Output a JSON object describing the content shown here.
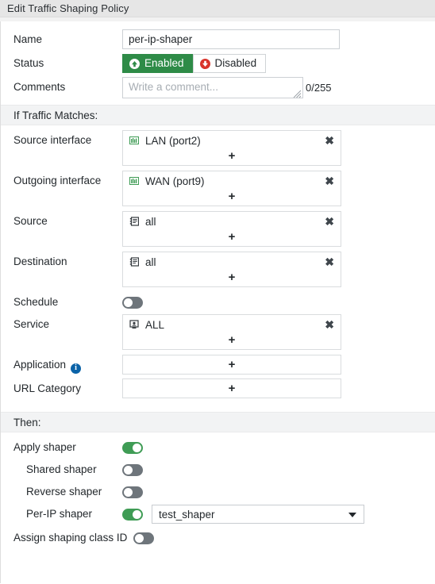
{
  "window": {
    "title": "Edit Traffic Shaping Policy"
  },
  "form": {
    "name": {
      "label": "Name",
      "value": "per-ip-shaper",
      "placeholder": ""
    },
    "status": {
      "label": "Status",
      "enabled_label": "Enabled",
      "disabled_label": "Disabled",
      "selected": "Enabled"
    },
    "comments": {
      "label": "Comments",
      "value": "",
      "placeholder": "Write a comment...",
      "counter": "0/255"
    }
  },
  "if_section": {
    "title": "If Traffic Matches:",
    "source_interface": {
      "label": "Source interface",
      "items": [
        {
          "icon": "interface-port-icon",
          "text": "LAN (port2)"
        }
      ],
      "add_label": "+",
      "remove_label": "✖"
    },
    "outgoing_interface": {
      "label": "Outgoing interface",
      "items": [
        {
          "icon": "interface-port-icon",
          "text": "WAN (port9)"
        }
      ],
      "add_label": "+",
      "remove_label": "✖"
    },
    "source": {
      "label": "Source",
      "items": [
        {
          "icon": "address-object-icon",
          "text": "all"
        }
      ],
      "add_label": "+",
      "remove_label": "✖"
    },
    "destination": {
      "label": "Destination",
      "items": [
        {
          "icon": "address-object-icon",
          "text": "all"
        }
      ],
      "add_label": "+",
      "remove_label": "✖"
    },
    "schedule": {
      "label": "Schedule",
      "state": "off"
    },
    "service": {
      "label": "Service",
      "items": [
        {
          "icon": "service-object-icon",
          "text": "ALL"
        }
      ],
      "add_label": "+",
      "remove_label": "✖"
    },
    "application": {
      "label": "Application",
      "info_icon": "info-icon",
      "info_glyph": "i",
      "add_label": "+"
    },
    "url_category": {
      "label": "URL Category",
      "add_label": "+"
    }
  },
  "then_section": {
    "title": "Then:",
    "apply_shaper": {
      "label": "Apply shaper",
      "state": "on"
    },
    "shared_shaper": {
      "label": "Shared shaper",
      "state": "off"
    },
    "reverse_shaper": {
      "label": "Reverse shaper",
      "state": "off"
    },
    "per_ip_shaper": {
      "label": "Per-IP shaper",
      "state": "on",
      "selected_option": "test_shaper"
    },
    "assign_class_id": {
      "label": "Assign shaping class ID",
      "state": "off"
    }
  },
  "colors": {
    "accent_green": "#2e8b47",
    "toggle_on": "#3f9c55",
    "toggle_off": "#6e757b",
    "danger_red": "#d9342b",
    "info_blue": "#0b63a8",
    "band_bg": "#f2f3f4",
    "titlebar_bg": "#e6e6e6"
  }
}
